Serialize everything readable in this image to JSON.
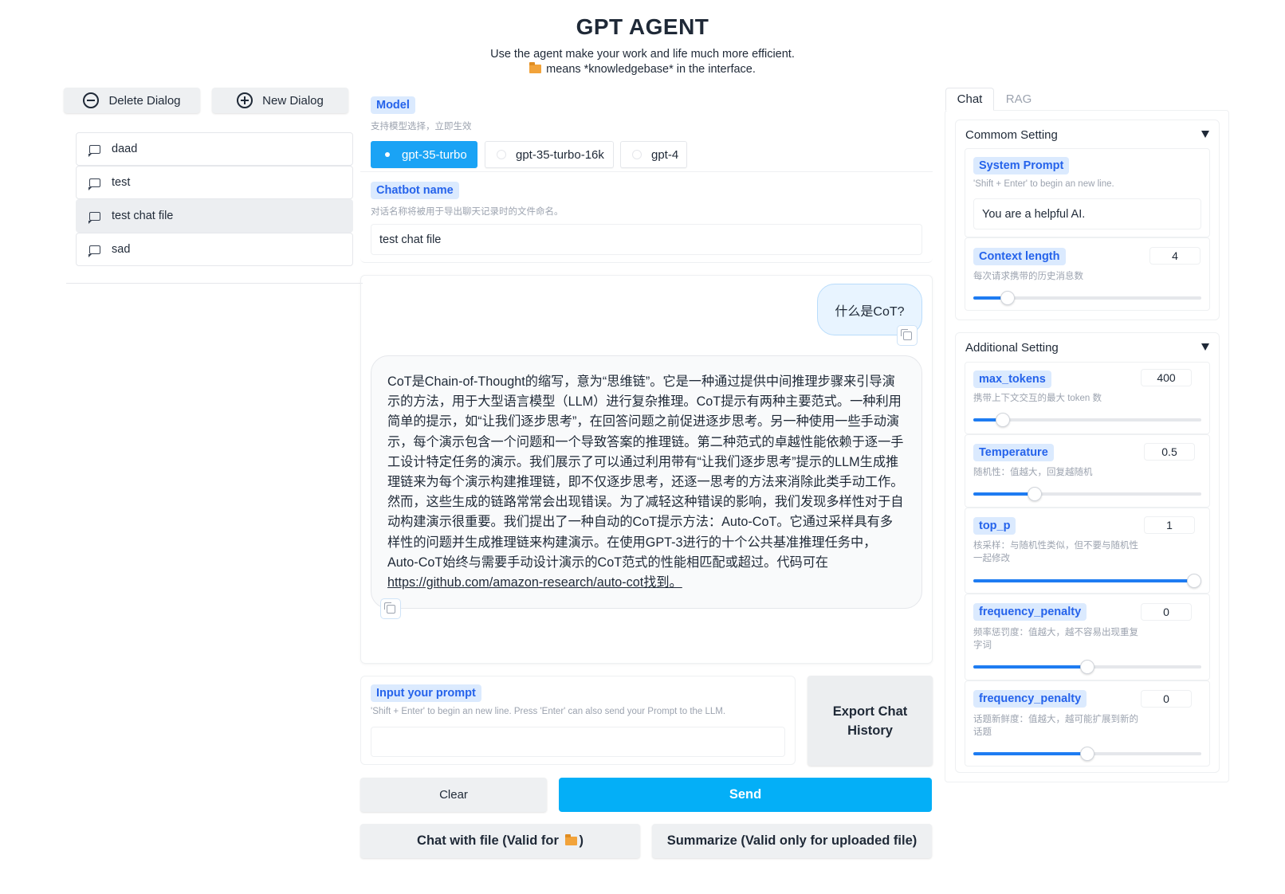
{
  "header": {
    "title": "GPT AGENT",
    "subtitle": "Use the agent make your work and life much more efficient.",
    "subtitle2": "means *knowledgebase* in the interface."
  },
  "left": {
    "delete_label": "Delete Dialog",
    "new_label": "New Dialog",
    "dialogs": [
      {
        "label": "daad"
      },
      {
        "label": "test"
      },
      {
        "label": "test chat file"
      },
      {
        "label": "sad"
      }
    ]
  },
  "model": {
    "label": "Model",
    "hint": "支持模型选择，立即生效",
    "options": [
      "gpt-35-turbo",
      "gpt-35-turbo-16k",
      "gpt-4"
    ],
    "selected": "gpt-35-turbo"
  },
  "chatbot_name": {
    "label": "Chatbot name",
    "hint": "对话名称将被用于导出聊天记录时的文件命名。",
    "value": "test chat file"
  },
  "chat": {
    "user_message": "什么是CoT?",
    "bot_message_text": "CoT是Chain-of-Thought的缩写，意为“思维链”。它是一种通过提供中间推理步骤来引导演示的方法，用于大型语言模型（LLM）进行复杂推理。CoT提示有两种主要范式。一种利用简单的提示，如“让我们逐步思考”，在回答问题之前促进逐步思考。另一种使用一些手动演示，每个演示包含一个问题和一个导致答案的推理链。第二种范式的卓越性能依赖于逐一手工设计特定任务的演示。我们展示了可以通过利用带有“让我们逐步思考”提示的LLM生成推理链来为每个演示构建推理链，即不仅逐步思考，还逐一思考的方法来消除此类手动工作。然而，这些生成的链路常常会出现错误。为了减轻这种错误的影响，我们发现多样性对于自动构建演示很重要。我们提出了一种自动的CoT提示方法：Auto-CoT。它通过采样具有多样性的问题并生成推理链来构建演示。在使用GPT-3进行的十个公共基准推理任务中，Auto-CoT始终与需要手动设计演示的CoT范式的性能相匹配或超过。代码可在",
    "bot_message_link": "https://github.com/amazon-research/auto-cot找到。"
  },
  "prompt": {
    "label": "Input your prompt",
    "hint": "'Shift + Enter' to begin an new line. Press 'Enter' can also send your Prompt to the LLM.",
    "value": ""
  },
  "buttons": {
    "export_line1": "Export Chat",
    "export_line2": "History",
    "clear": "Clear",
    "send": "Send",
    "chat_with_file_a": "Chat with file (Valid for",
    "chat_with_file_b": ")",
    "summarize": "Summarize (Valid only for uploaded file)"
  },
  "right": {
    "tabs": [
      "Chat",
      "RAG"
    ],
    "active_tab": "Chat",
    "common_title": "Commom Setting",
    "system_prompt": {
      "label": "System Prompt",
      "hint": "'Shift + Enter' to begin an new line.",
      "value": "You are a helpful AI."
    },
    "context_length": {
      "label": "Context length",
      "hint": "每次请求携带的历史消息数",
      "value": "4",
      "fraction": 0.15
    },
    "additional_title": "Additional Setting",
    "max_tokens": {
      "label": "max_tokens",
      "hint": "携带上下文交互的最大 token 数",
      "value": "400",
      "fraction": 0.13
    },
    "temperature": {
      "label": "Temperature",
      "hint": "随机性：值越大，回复越随机",
      "value": "0.5",
      "fraction": 0.27
    },
    "top_p": {
      "label": "top_p",
      "hint": "核采样：与随机性类似，但不要与随机性一起修改",
      "value": "1",
      "fraction": 0.97
    },
    "frequency_penalty": {
      "label": "frequency_penalty",
      "hint": "频率惩罚度：值越大，越不容易出现重复字词",
      "value": "0",
      "fraction": 0.5
    },
    "presence_penalty": {
      "label": "frequency_penalty",
      "hint": "话题新鲜度：值越大，越可能扩展到新的话题",
      "value": "0",
      "fraction": 0.5
    }
  }
}
